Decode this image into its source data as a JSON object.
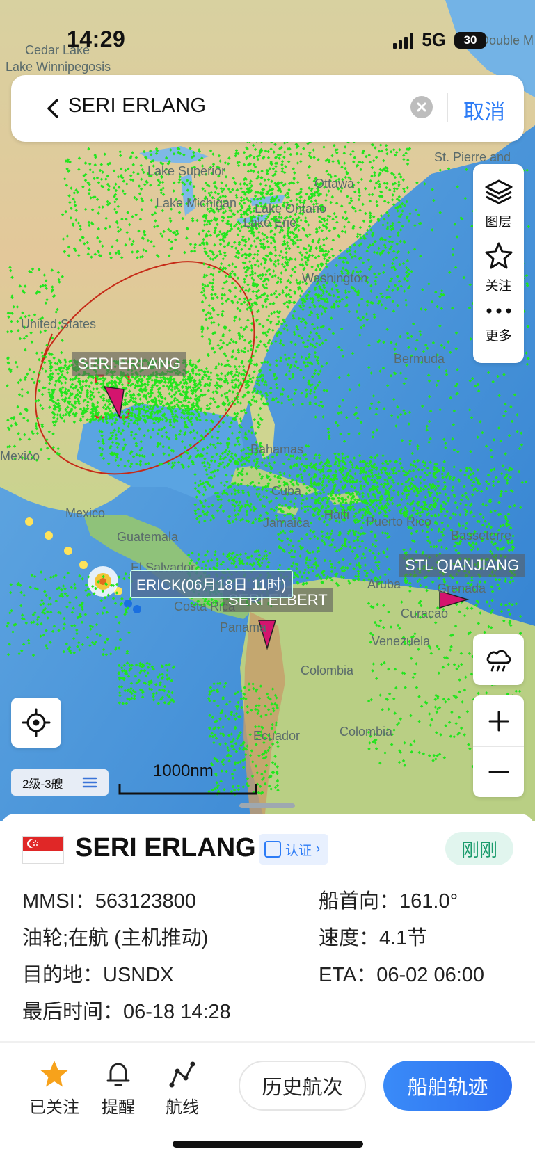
{
  "status_bar": {
    "time": "14:29",
    "network": "5G",
    "battery": "30"
  },
  "search": {
    "query": "SERI ERLANG",
    "cancel_label": "取消"
  },
  "tools": {
    "layers": "图层",
    "follow": "关注",
    "more": "更多"
  },
  "map": {
    "place_labels": [
      "Cedar Lake",
      "Lake Winnipegosis",
      "Lake Superior",
      "Ottawa",
      "Lake Michigan",
      "Lake Ontario",
      "Lake Erie",
      "Washington",
      "United States",
      "Bermuda",
      "Mexico",
      "Mexico",
      "Bahamas",
      "Cuba",
      "Haiti",
      "Jamaica",
      "Puerto Rico",
      "Basseterre",
      "Guatemala",
      "El Salvador",
      "Costa Rica",
      "Panama",
      "Aruba",
      "Curacao",
      "Grenada",
      "Venezuela",
      "Colombia",
      "Colombia",
      "Ecuador",
      "St. Pierre and",
      "Double M"
    ],
    "ships": [
      {
        "label": "SERI ERLANG",
        "selected": true
      },
      {
        "label": "SERI ELBERT",
        "selected": false
      },
      {
        "label": "STL QIANJIANG",
        "selected": false
      }
    ],
    "storm_label": "ERICK(06月18日 11时)",
    "level_label": "2级-3艘",
    "scale_label": "1000nm",
    "colors": {
      "ship_dots": "#22e51e",
      "ship_marker": "#d4146e",
      "annotation_circle": "#c62a17",
      "ocean": "#3f8fd8"
    }
  },
  "vessel": {
    "name": "SERI ERLANG",
    "flag": "Singapore",
    "verify_label": "认证",
    "updated": "刚刚",
    "mmsi": "MMSI：563123800",
    "heading": "船首向：161.0°",
    "type": "油轮;在航 (主机推动)",
    "speed": "速度：4.1节",
    "destination": "目的地：USNDX",
    "eta": "ETA：06-02 06:00",
    "last_time": "最后时间：06-18 14:28"
  },
  "actions": {
    "followed": "已关注",
    "remind": "提醒",
    "route": "航线",
    "history": "历史航次",
    "track": "船舶轨迹"
  }
}
